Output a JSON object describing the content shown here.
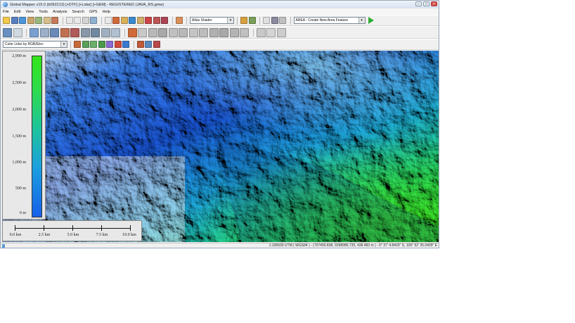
{
  "window": {
    "title": "Global Mapper v15.0 (b092213) [+DTF] [+Lidar] [+GEM] - REGISTERED (JAVA_RS.gmw)",
    "minimize_label": "–",
    "maximize_label": "□",
    "close_label": "×"
  },
  "menu": [
    "File",
    "Edit",
    "View",
    "Tools",
    "Analysis",
    "Search",
    "GPS",
    "Help"
  ],
  "toolbar": {
    "shader_select": "Atlas Shader",
    "digitizer_mode_select": "AREA - Create New Area Feature",
    "lidar_color_select": "Color Lidar by RGB/Elev"
  },
  "legend": {
    "labels": [
      "2,999 m",
      "2,500 m",
      "2,000 m",
      "1,500 m",
      "1,000 m",
      "500 m",
      "0 m"
    ]
  },
  "scale": {
    "labels": [
      "0.0 km",
      "2.5 km",
      "5.0 km",
      "7.5 km",
      "10.0 km"
    ]
  },
  "status": {
    "text": "1:105500  UTM ( WGS84 ) - (707450.838, 9268986.735, 438.483 m ) - 6° 37' 4.8403\" S, 106° 52' 35.0409\" E"
  },
  "colors": {
    "elev_low": "#1660e8",
    "elev_mid": "#1ec39b",
    "elev_high": "#33e61a",
    "hillshade": "#d8dde0"
  }
}
